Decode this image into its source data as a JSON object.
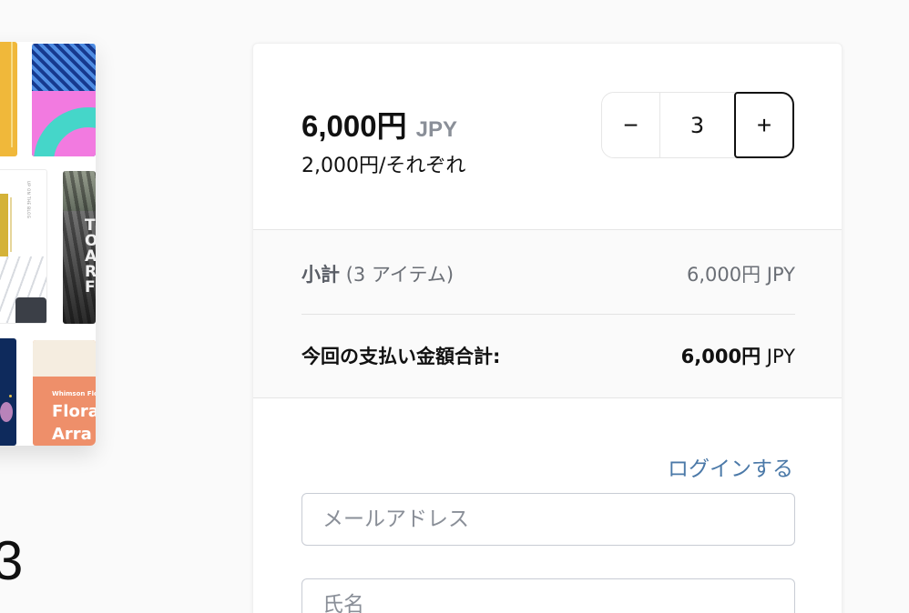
{
  "preview": {
    "thumb3_text": "UP ON THE BLOG",
    "thumb4_letters": "T\nO\nA\nR\nF",
    "thumb6_small": "Whimson Flo",
    "thumb6_big": "Flora\nArra"
  },
  "page_number": "3",
  "product": {
    "price": "6,000円",
    "currency": "JPY",
    "unit_price": "2,000円/それぞれ"
  },
  "quantity": {
    "minus_label": "−",
    "value": "3",
    "plus_label": "+"
  },
  "summary": {
    "subtotal_label": "小計",
    "subtotal_count": "(3 アイテム)",
    "subtotal_value": "6,000円 JPY",
    "total_label": "今回の支払い金額合計:",
    "total_amount": "6,000円",
    "total_currency": "JPY"
  },
  "form": {
    "login_link": "ログインする",
    "email_placeholder": "メールアドレス",
    "name_placeholder": "氏名"
  }
}
